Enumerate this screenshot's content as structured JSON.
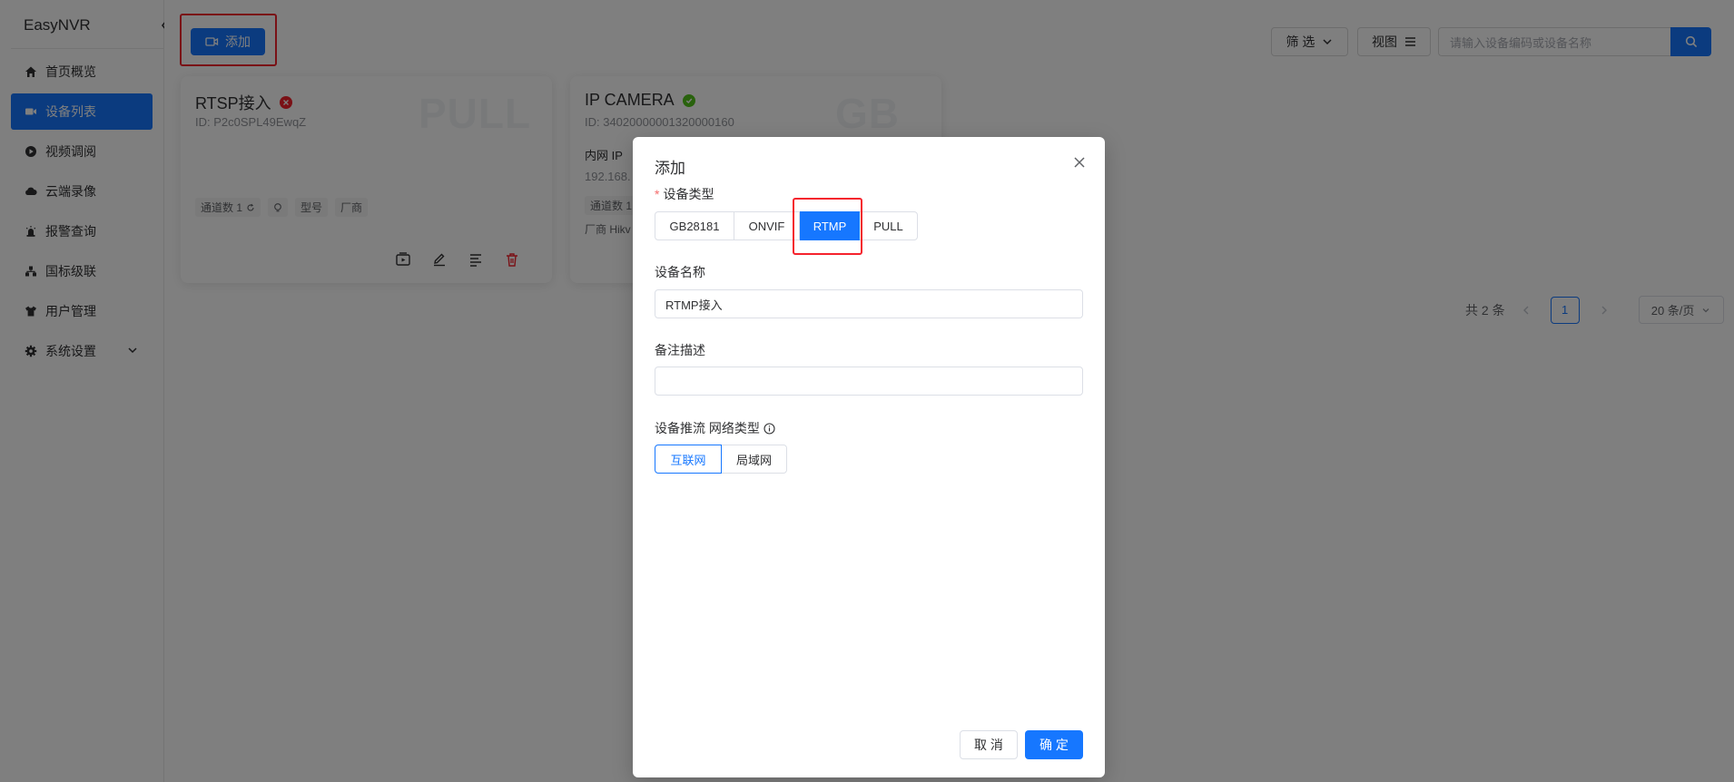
{
  "app": {
    "brand": "EasyNVR"
  },
  "sidebar": {
    "items": [
      {
        "label": "首页概览",
        "icon": "home-icon"
      },
      {
        "label": "设备列表",
        "icon": "camera-icon",
        "active": true
      },
      {
        "label": "视频调阅",
        "icon": "play-icon"
      },
      {
        "label": "云端录像",
        "icon": "cloud-icon"
      },
      {
        "label": "报警查询",
        "icon": "alarm-icon"
      },
      {
        "label": "国标级联",
        "icon": "cascade-icon"
      },
      {
        "label": "用户管理",
        "icon": "user-icon"
      },
      {
        "label": "系统设置",
        "icon": "gear-icon"
      }
    ]
  },
  "toolbar": {
    "add_label": "添加",
    "filter_label": "筛 选",
    "view_label": "视图",
    "search_placeholder": "请输入设备编码或设备名称"
  },
  "cards": [
    {
      "title": "RTSP接入",
      "status": "offline",
      "id_text": "ID: P2c0SPL49EwqZ",
      "watermark": "PULL",
      "tags": [
        "通道数 1",
        "",
        "型号",
        "厂商"
      ]
    },
    {
      "title": "IP CAMERA",
      "status": "online",
      "id_text": "ID: 34020000001320000160",
      "watermark": "GB",
      "ip_label": "内网 IP",
      "ip_value": "192.168.",
      "channel_tag": "通道数 1",
      "vendor": "厂商 Hikv"
    }
  ],
  "pagination": {
    "total": "共 2 条",
    "current_page": "1",
    "page_size": "20 条/页"
  },
  "modal": {
    "title": "添加",
    "device_type_label": "设备类型",
    "device_types": [
      "GB28181",
      "ONVIF",
      "RTMP",
      "PULL"
    ],
    "selected_type": "RTMP",
    "name_label": "设备名称",
    "name_value": "RTMP接入",
    "remark_label": "备注描述",
    "remark_value": "",
    "network_label": "设备推流 网络类型",
    "network_options": [
      "互联网",
      "局域网"
    ],
    "selected_network": "互联网",
    "cancel_label": "取 消",
    "ok_label": "确 定"
  },
  "colors": {
    "primary": "#1677ff",
    "highlight": "#f5222d",
    "online": "#52c41a",
    "offline": "#f5222d"
  }
}
